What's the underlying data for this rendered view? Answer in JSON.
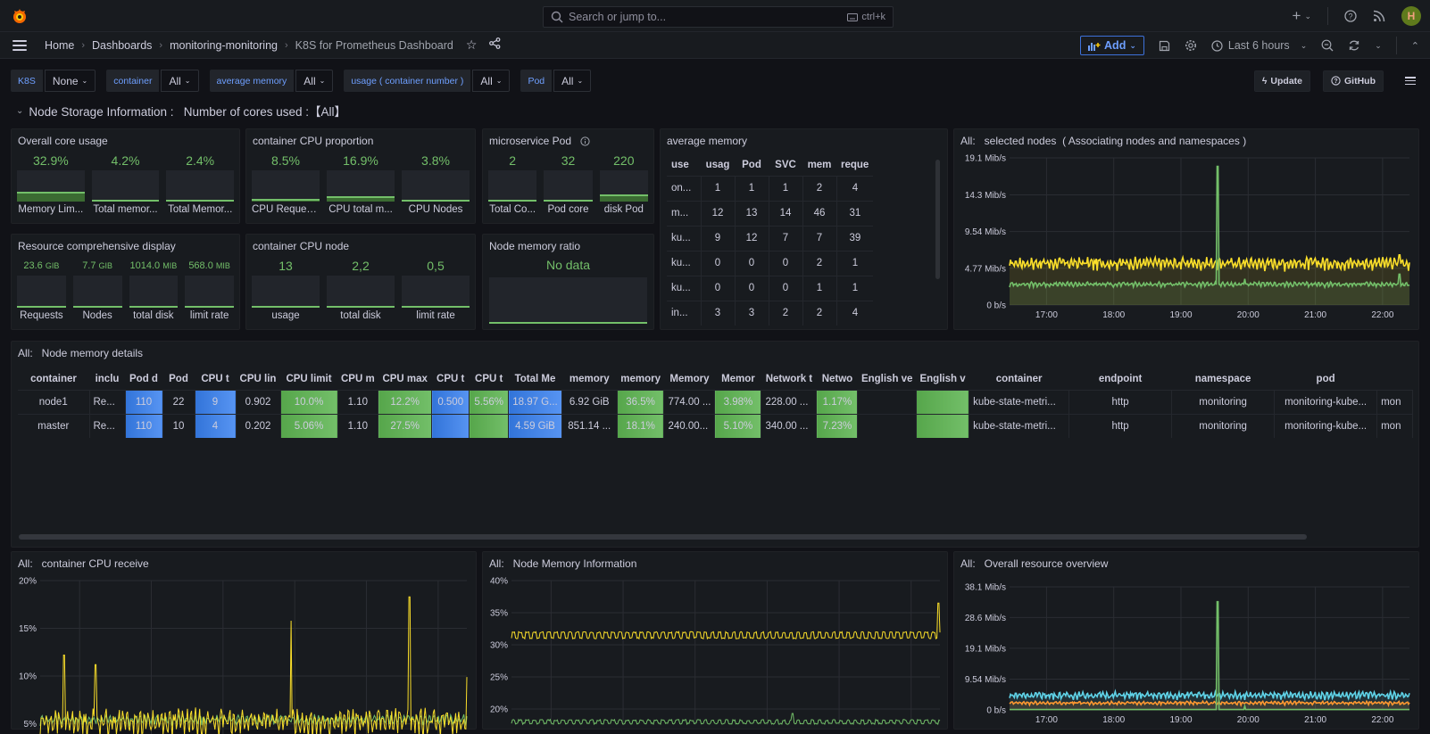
{
  "topbar": {
    "search_placeholder": "Search or jump to...",
    "search_shortcut": "ctrl+k",
    "icons": [
      "grafana-logo-icon",
      "plus-icon",
      "help-icon",
      "news-rss-icon",
      "user-avatar"
    ],
    "avatar_initial": "H"
  },
  "breadcrumb": [
    {
      "label": "Home"
    },
    {
      "label": "Dashboards"
    },
    {
      "label": "monitoring-monitoring"
    },
    {
      "label": "K8S for Prometheus Dashboard"
    }
  ],
  "toolbar": {
    "add_label": "Add",
    "time_range": "Last 6 hours"
  },
  "variables": [
    {
      "label": "K8S",
      "value": "None"
    },
    {
      "label": "container",
      "value": "All"
    },
    {
      "label": "average memory",
      "value": "All"
    },
    {
      "label": "usage ( container number )",
      "value": "All"
    },
    {
      "label": "Pod",
      "value": "All"
    }
  ],
  "links": {
    "update": "Update",
    "github": "GitHub"
  },
  "row_title": "Node Storage Information :   Number of cores used :【All】",
  "panels": {
    "overall_core": {
      "title": "Overall core usage",
      "gauges": [
        {
          "value": "32.9%",
          "label": "Memory Lim...",
          "fill": 0.329
        },
        {
          "value": "4.2%",
          "label": "Total memor...",
          "fill": 0.042
        },
        {
          "value": "2.4%",
          "label": "Total Memor...",
          "fill": 0.024
        }
      ]
    },
    "cpu_proportion": {
      "title": "container CPU proportion",
      "gauges": [
        {
          "value": "8.5%",
          "label": "CPU Reques...",
          "fill": 0.085
        },
        {
          "value": "16.9%",
          "label": "CPU total m...",
          "fill": 0.169
        },
        {
          "value": "3.8%",
          "label": "CPU Nodes",
          "fill": 0.038
        }
      ]
    },
    "microservice_pod": {
      "title": "microservice Pod",
      "gauges": [
        {
          "value": "2",
          "label": "Total Co...",
          "fill": 0.01
        },
        {
          "value": "32",
          "label": "Pod core",
          "fill": 0.02
        },
        {
          "value": "220",
          "label": "disk Pod",
          "fill": 0.22
        }
      ]
    },
    "resource_display": {
      "title": "Resource comprehensive display",
      "gauges": [
        {
          "value": "23.6",
          "unit": "GIB",
          "label": "Requests",
          "fill": 0.0
        },
        {
          "value": "7.7",
          "unit": "GIB",
          "label": "Nodes",
          "fill": 0.0
        },
        {
          "value": "1014.0",
          "unit": "MIB",
          "label": "total disk",
          "fill": 0.0
        },
        {
          "value": "568.0",
          "unit": "MIB",
          "label": "limit rate",
          "fill": 0.0
        }
      ]
    },
    "cpu_node": {
      "title": "container CPU node",
      "gauges": [
        {
          "value": "13",
          "label": "usage",
          "fill": 0.0
        },
        {
          "value": "2,2",
          "label": "total disk",
          "fill": 0.0
        },
        {
          "value": "0,5",
          "label": "limit rate",
          "fill": 0.0
        }
      ]
    },
    "node_memory_ratio": {
      "title": "Node memory ratio",
      "no_data": "No data"
    },
    "average_memory": {
      "title": "average memory",
      "columns": [
        "use",
        "usag",
        "Pod",
        "SVC",
        "mem",
        "reque"
      ],
      "rows": [
        [
          "on...",
          "1",
          "1",
          "1",
          "2",
          "4"
        ],
        [
          "m...",
          "12",
          "13",
          "14",
          "46",
          "31"
        ],
        [
          "ku...",
          "9",
          "12",
          "7",
          "7",
          "39"
        ],
        [
          "ku...",
          "0",
          "0",
          "0",
          "2",
          "1"
        ],
        [
          "ku...",
          "0",
          "0",
          "0",
          "1",
          "1"
        ],
        [
          "in...",
          "3",
          "3",
          "2",
          "2",
          "4"
        ]
      ]
    },
    "node_memory_details": {
      "title": "All:   Node memory details",
      "columns": [
        "container",
        "inclu",
        "Pod d",
        "Pod",
        "CPU t",
        "CPU lin",
        "CPU limit",
        "CPU m",
        "CPU max",
        "CPU t",
        "CPU t",
        "Total Me",
        "memory",
        "memory",
        "Memory",
        "Memor",
        "Network t",
        "Netwo",
        "English ve",
        "English v",
        "container",
        "endpoint",
        "namespace",
        "pod",
        ""
      ],
      "rows": [
        {
          "cells": [
            "node1",
            "Re...",
            "110",
            "22",
            "9",
            "0.902",
            "10.0%",
            "1.10",
            "12.2%",
            "0.500",
            "5.56%",
            "18.97 G...",
            "6.92 GiB",
            "36.5%",
            "774.00 ...",
            "3.98%",
            "228.00 ...",
            "1.17%",
            "",
            "",
            "kube-state-metri...",
            "http",
            "monitoring",
            "monitoring-kube...",
            "mon"
          ]
        },
        {
          "cells": [
            "master",
            "Re...",
            "110",
            "10",
            "4",
            "0.202",
            "5.06%",
            "1.10",
            "27.5%",
            "",
            "",
            "4.59 GiB",
            "851.14 ...",
            "18.1%",
            "240.00...",
            "5.10%",
            "340.00 ...",
            "7.23%",
            "",
            "",
            "kube-state-metri...",
            "http",
            "monitoring",
            "monitoring-kube...",
            "mon"
          ]
        }
      ]
    }
  },
  "chart_data": [
    {
      "id": "selected_nodes",
      "type": "area",
      "title": "All:   selected nodes  ( Associating nodes and namespaces )",
      "yticks": [
        "0 b/s",
        "4.77 Mib/s",
        "9.54 Mib/s",
        "14.3 Mib/s",
        "19.1 Mib/s"
      ],
      "ylim": [
        0,
        19.1
      ],
      "xticks": [
        "17:00",
        "18:00",
        "19:00",
        "20:00",
        "21:00",
        "22:00"
      ],
      "x_range_hours": [
        16.45,
        22.4
      ],
      "series": [
        {
          "name": "yellow",
          "color": "#fade2a",
          "base": 5.2,
          "amp": 0.9,
          "spikes": [
            [
              22.25,
              6.5
            ]
          ]
        },
        {
          "name": "green",
          "color": "#73bf69",
          "base": 2.6,
          "amp": 0.35,
          "spikes": [
            [
              19.55,
              18.0
            ],
            [
              19.95,
              3.4
            ],
            [
              22.25,
              4.0
            ]
          ]
        }
      ]
    },
    {
      "id": "cpu_receive",
      "type": "line",
      "title": "All:   container CPU receive",
      "yticks": [
        "5%",
        "10%",
        "15%",
        "20%"
      ],
      "ylim": [
        3,
        20
      ],
      "xticks": [],
      "x_range_hours": [
        16.45,
        22.4
      ],
      "series": [
        {
          "name": "green",
          "color": "#73bf69",
          "base": 5.3,
          "amp": 0.6,
          "spikes": []
        },
        {
          "name": "yellow",
          "color": "#fade2a",
          "base": 4.8,
          "amp": 1.6,
          "spikes": [
            [
              16.78,
              12.2
            ],
            [
              17.22,
              11.2
            ],
            [
              19.95,
              15.8
            ],
            [
              21.6,
              18.3
            ],
            [
              22.4,
              9.9
            ]
          ]
        }
      ]
    },
    {
      "id": "node_memory_info",
      "type": "line",
      "title": "All:   Node Memory Information",
      "yticks": [
        "20%",
        "25%",
        "30%",
        "35%",
        "40%"
      ],
      "ylim": [
        17.5,
        40
      ],
      "xticks": [],
      "x_range_hours": [
        16.45,
        22.4
      ],
      "series": [
        {
          "name": "yellow",
          "color": "#fade2a",
          "base": 31.5,
          "amp": 0.5,
          "spikes": [
            [
              22.38,
              36.5
            ]
          ]
        },
        {
          "name": "green",
          "color": "#73bf69",
          "base": 18.0,
          "amp": 0.3,
          "spikes": [
            [
              20.35,
              19.3
            ]
          ]
        }
      ]
    },
    {
      "id": "resource_overview",
      "type": "area",
      "title": "All:   Overall resource overview",
      "yticks": [
        "0 b/s",
        "9.54 Mib/s",
        "19.1 Mib/s",
        "28.6 Mib/s",
        "38.1 Mib/s"
      ],
      "ylim": [
        0,
        38.1
      ],
      "xticks": [
        "17:00",
        "18:00",
        "19:00",
        "20:00",
        "21:00",
        "22:00"
      ],
      "x_range_hours": [
        16.45,
        22.4
      ],
      "series": [
        {
          "name": "cyan",
          "color": "#5fd3e8",
          "base": 4.2,
          "amp": 1.3,
          "spikes": []
        },
        {
          "name": "orange",
          "color": "#ff9830",
          "base": 2.0,
          "amp": 0.6,
          "spikes": []
        },
        {
          "name": "green",
          "color": "#73bf69",
          "base": 0.1,
          "amp": 0.0,
          "spikes": [
            [
              19.55,
              33.5
            ],
            [
              19.95,
              1.2
            ]
          ]
        }
      ]
    }
  ]
}
